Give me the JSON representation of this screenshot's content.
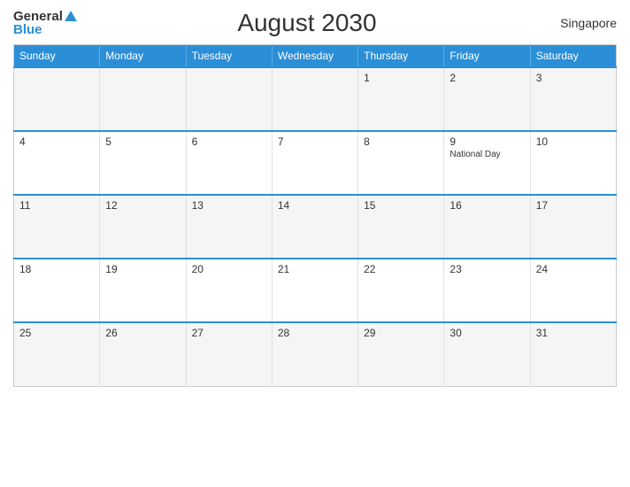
{
  "header": {
    "logo_general": "General",
    "logo_blue": "Blue",
    "title": "August 2030",
    "region": "Singapore"
  },
  "days_of_week": [
    "Sunday",
    "Monday",
    "Tuesday",
    "Wednesday",
    "Thursday",
    "Friday",
    "Saturday"
  ],
  "weeks": [
    [
      {
        "day": "",
        "holiday": ""
      },
      {
        "day": "",
        "holiday": ""
      },
      {
        "day": "",
        "holiday": ""
      },
      {
        "day": "",
        "holiday": ""
      },
      {
        "day": "1",
        "holiday": ""
      },
      {
        "day": "2",
        "holiday": ""
      },
      {
        "day": "3",
        "holiday": ""
      }
    ],
    [
      {
        "day": "4",
        "holiday": ""
      },
      {
        "day": "5",
        "holiday": ""
      },
      {
        "day": "6",
        "holiday": ""
      },
      {
        "day": "7",
        "holiday": ""
      },
      {
        "day": "8",
        "holiday": ""
      },
      {
        "day": "9",
        "holiday": "National Day"
      },
      {
        "day": "10",
        "holiday": ""
      }
    ],
    [
      {
        "day": "11",
        "holiday": ""
      },
      {
        "day": "12",
        "holiday": ""
      },
      {
        "day": "13",
        "holiday": ""
      },
      {
        "day": "14",
        "holiday": ""
      },
      {
        "day": "15",
        "holiday": ""
      },
      {
        "day": "16",
        "holiday": ""
      },
      {
        "day": "17",
        "holiday": ""
      }
    ],
    [
      {
        "day": "18",
        "holiday": ""
      },
      {
        "day": "19",
        "holiday": ""
      },
      {
        "day": "20",
        "holiday": ""
      },
      {
        "day": "21",
        "holiday": ""
      },
      {
        "day": "22",
        "holiday": ""
      },
      {
        "day": "23",
        "holiday": ""
      },
      {
        "day": "24",
        "holiday": ""
      }
    ],
    [
      {
        "day": "25",
        "holiday": ""
      },
      {
        "day": "26",
        "holiday": ""
      },
      {
        "day": "27",
        "holiday": ""
      },
      {
        "day": "28",
        "holiday": ""
      },
      {
        "day": "29",
        "holiday": ""
      },
      {
        "day": "30",
        "holiday": ""
      },
      {
        "day": "31",
        "holiday": ""
      }
    ]
  ]
}
